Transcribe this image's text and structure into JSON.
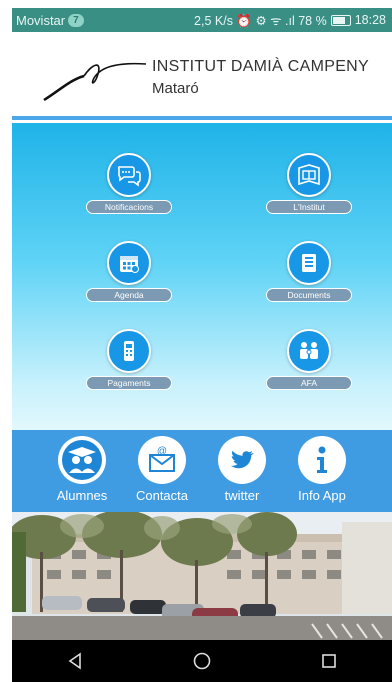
{
  "status_bar": {
    "carrier": "Movistar",
    "badge": "7",
    "indicators": "2,5 K/s ⏰ ⚙ ᯤ .ıl 78 %",
    "time": "18:28"
  },
  "header": {
    "school_name": "INSTITUT  DAMIÀ  CAMPENY",
    "city": "Mataró"
  },
  "menu": {
    "items": [
      {
        "label": "Notificacions",
        "icon": "speech-bubbles-icon"
      },
      {
        "label": "L'Institut",
        "icon": "open-book-icon"
      },
      {
        "label": "Agenda",
        "icon": "calendar-icon"
      },
      {
        "label": "Documents",
        "icon": "documents-icon"
      },
      {
        "label": "Pagaments",
        "icon": "payment-terminal-icon"
      },
      {
        "label": "AFA",
        "icon": "family-icon"
      }
    ]
  },
  "quickbar": {
    "items": [
      {
        "label": "Alumnes",
        "icon": "students-icon"
      },
      {
        "label": "Contacta",
        "icon": "email-icon"
      },
      {
        "label": "twitter",
        "icon": "twitter-icon"
      },
      {
        "label": "Info App",
        "icon": "info-icon"
      }
    ]
  },
  "colors": {
    "status_bar": "#3a8f85",
    "menu_top": "#1fb3e8",
    "icon_circle": "#1797e5",
    "label_pill": "#7c9ab3",
    "quickbar": "#3f9ce3"
  }
}
